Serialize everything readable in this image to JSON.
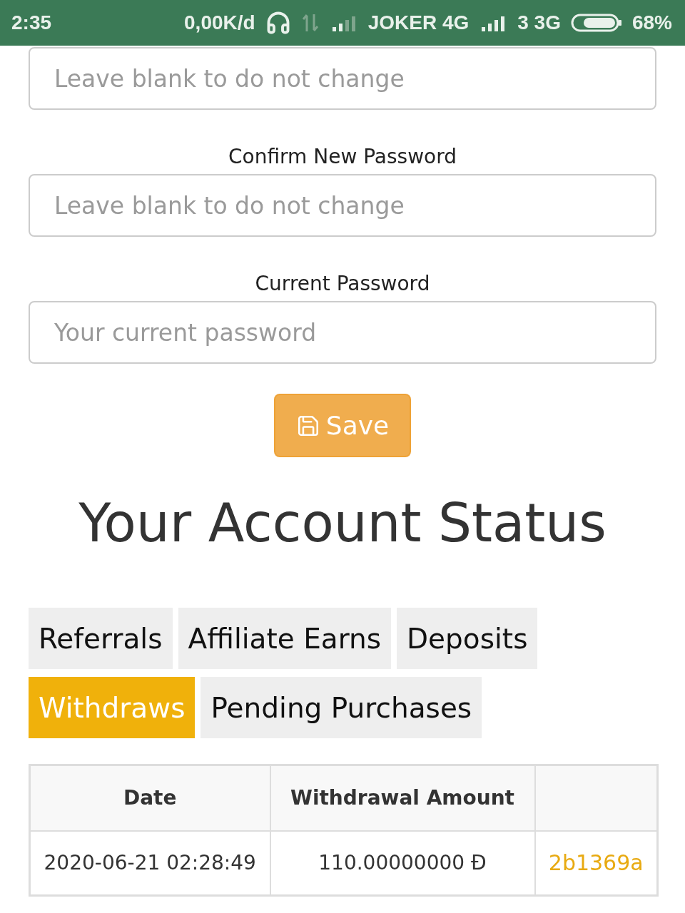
{
  "status_bar": {
    "time": "2:35",
    "network_speed": "0,00K/d",
    "carrier_1": "JOKER 4G",
    "carrier_2": "3 3G",
    "battery": "68%"
  },
  "form": {
    "fields": [
      {
        "placeholder": "Leave blank to do not change"
      },
      {
        "label": "Confirm New Password",
        "placeholder": "Leave blank to do not change"
      },
      {
        "label": "Current Password",
        "placeholder": "Your current password"
      }
    ],
    "save_button": "Save"
  },
  "account_status": {
    "title": "Your Account Status",
    "tabs": [
      {
        "label": "Referrals",
        "selected": false
      },
      {
        "label": "Affiliate Earns",
        "selected": false
      },
      {
        "label": "Deposits",
        "selected": false
      },
      {
        "label": "Withdraws",
        "selected": true
      },
      {
        "label": "Pending Purchases",
        "selected": false
      }
    ],
    "table": {
      "columns": [
        "Date",
        "Withdrawal Amount"
      ],
      "rows": [
        {
          "cells": [
            {
              "kind": "text",
              "text": "2020-06-21 02:28:49"
            },
            {
              "kind": "text",
              "text": "110.00000000 Đ"
            },
            {
              "kind": "link",
              "text": "2b1369a"
            }
          ]
        }
      ]
    }
  }
}
